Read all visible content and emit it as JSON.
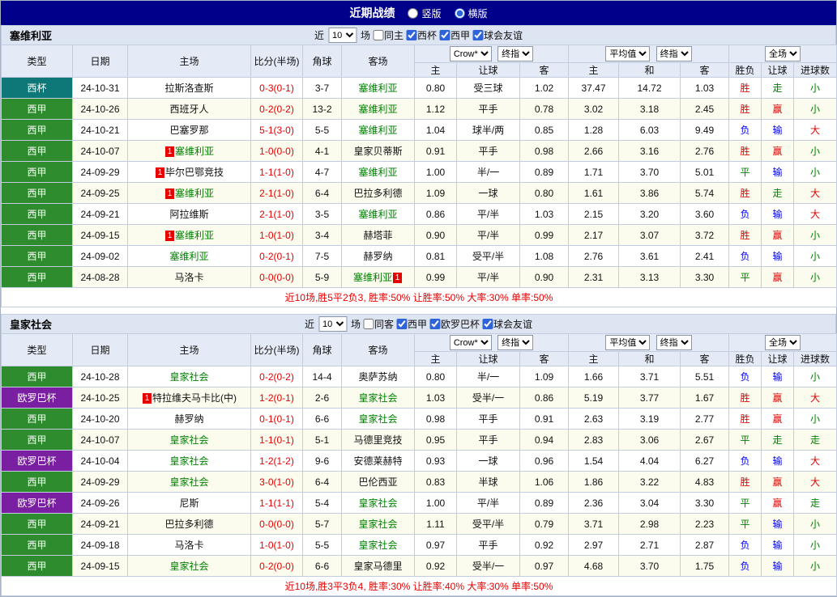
{
  "title_bar": {
    "title": "近期战绩",
    "vertical": "竖版",
    "horizontal": "横版",
    "selected": "横版"
  },
  "colors": {
    "title_navy": "#00008b",
    "liga_green": "#2e8b2e",
    "cup_teal": "#0e7878",
    "europa_purple": "#7b1fa2",
    "win_red": "#e60000",
    "loss_blue": "#0000ee",
    "draw_green": "#008000"
  },
  "columns": {
    "type": "类型",
    "date": "日期",
    "home": "主场",
    "score": "比分(半场)",
    "corner": "角球",
    "away": "客场",
    "odds_book": "Crow*",
    "odds_final": "终指",
    "avg": "平均值",
    "avg_final": "终指",
    "scope": "全场",
    "home_s": "主",
    "hand": "让球",
    "away_s": "客",
    "avg_h": "主",
    "avg_d": "和",
    "avg_a": "客",
    "res1": "胜负",
    "res2": "让球",
    "res3": "进球数"
  },
  "sections": [
    {
      "team": "塞维利亚",
      "filter": {
        "near": "近",
        "count": "10",
        "games": "场",
        "same": "同主",
        "leagues": [
          "西杯",
          "西甲",
          "球会友谊"
        ]
      },
      "rows": [
        {
          "type": "西杯",
          "type_color": "teal",
          "date": "24-10-31",
          "home": {
            "name": "拉斯洛查斯",
            "green": false,
            "badge": ""
          },
          "score": "0-3(0-1)",
          "corner": "3-7",
          "away": {
            "name": "塞维利亚",
            "green": true,
            "badge": ""
          },
          "odds": [
            "0.80",
            "受三球",
            "1.02"
          ],
          "avg": [
            "37.47",
            "14.72",
            "1.03"
          ],
          "results": [
            {
              "t": "胜",
              "c": "red"
            },
            {
              "t": "走",
              "c": "green"
            },
            {
              "t": "小",
              "c": "green"
            }
          ]
        },
        {
          "type": "西甲",
          "type_color": "green",
          "date": "24-10-26",
          "home": {
            "name": "西班牙人",
            "green": false,
            "badge": ""
          },
          "score": "0-2(0-2)",
          "corner": "13-2",
          "away": {
            "name": "塞维利亚",
            "green": true,
            "badge": ""
          },
          "odds": [
            "1.12",
            "平手",
            "0.78"
          ],
          "avg": [
            "3.02",
            "3.18",
            "2.45"
          ],
          "results": [
            {
              "t": "胜",
              "c": "red"
            },
            {
              "t": "赢",
              "c": "red"
            },
            {
              "t": "小",
              "c": "green"
            }
          ]
        },
        {
          "type": "西甲",
          "type_color": "green",
          "date": "24-10-21",
          "home": {
            "name": "巴塞罗那",
            "green": false,
            "badge": ""
          },
          "score": "5-1(3-0)",
          "corner": "5-5",
          "away": {
            "name": "塞维利亚",
            "green": true,
            "badge": ""
          },
          "odds": [
            "1.04",
            "球半/两",
            "0.85"
          ],
          "avg": [
            "1.28",
            "6.03",
            "9.49"
          ],
          "results": [
            {
              "t": "负",
              "c": "blue"
            },
            {
              "t": "输",
              "c": "blue"
            },
            {
              "t": "大",
              "c": "red"
            }
          ]
        },
        {
          "type": "西甲",
          "type_color": "green",
          "date": "24-10-07",
          "home": {
            "name": "塞维利亚",
            "green": true,
            "badge": "before"
          },
          "score": "1-0(0-0)",
          "corner": "4-1",
          "away": {
            "name": "皇家贝蒂斯",
            "green": false,
            "badge": ""
          },
          "odds": [
            "0.91",
            "平手",
            "0.98"
          ],
          "avg": [
            "2.66",
            "3.16",
            "2.76"
          ],
          "results": [
            {
              "t": "胜",
              "c": "red"
            },
            {
              "t": "赢",
              "c": "red"
            },
            {
              "t": "小",
              "c": "green"
            }
          ]
        },
        {
          "type": "西甲",
          "type_color": "green",
          "date": "24-09-29",
          "home": {
            "name": "毕尔巴鄂竞技",
            "green": false,
            "badge": "before"
          },
          "score": "1-1(1-0)",
          "corner": "4-7",
          "away": {
            "name": "塞维利亚",
            "green": true,
            "badge": ""
          },
          "odds": [
            "1.00",
            "半/一",
            "0.89"
          ],
          "avg": [
            "1.71",
            "3.70",
            "5.01"
          ],
          "results": [
            {
              "t": "平",
              "c": "green"
            },
            {
              "t": "输",
              "c": "blue"
            },
            {
              "t": "小",
              "c": "green"
            }
          ]
        },
        {
          "type": "西甲",
          "type_color": "green",
          "date": "24-09-25",
          "home": {
            "name": "塞维利亚",
            "green": true,
            "badge": "before"
          },
          "score": "2-1(1-0)",
          "corner": "6-4",
          "away": {
            "name": "巴拉多利德",
            "green": false,
            "badge": ""
          },
          "odds": [
            "1.09",
            "一球",
            "0.80"
          ],
          "avg": [
            "1.61",
            "3.86",
            "5.74"
          ],
          "results": [
            {
              "t": "胜",
              "c": "red"
            },
            {
              "t": "走",
              "c": "green"
            },
            {
              "t": "大",
              "c": "red"
            }
          ]
        },
        {
          "type": "西甲",
          "type_color": "green",
          "date": "24-09-21",
          "home": {
            "name": "阿拉维斯",
            "green": false,
            "badge": ""
          },
          "score": "2-1(1-0)",
          "corner": "3-5",
          "away": {
            "name": "塞维利亚",
            "green": true,
            "badge": ""
          },
          "odds": [
            "0.86",
            "平/半",
            "1.03"
          ],
          "avg": [
            "2.15",
            "3.20",
            "3.60"
          ],
          "results": [
            {
              "t": "负",
              "c": "blue"
            },
            {
              "t": "输",
              "c": "blue"
            },
            {
              "t": "大",
              "c": "red"
            }
          ]
        },
        {
          "type": "西甲",
          "type_color": "green",
          "date": "24-09-15",
          "home": {
            "name": "塞维利亚",
            "green": true,
            "badge": "before"
          },
          "score": "1-0(1-0)",
          "corner": "3-4",
          "away": {
            "name": "赫塔菲",
            "green": false,
            "badge": ""
          },
          "odds": [
            "0.90",
            "平/半",
            "0.99"
          ],
          "avg": [
            "2.17",
            "3.07",
            "3.72"
          ],
          "results": [
            {
              "t": "胜",
              "c": "red"
            },
            {
              "t": "赢",
              "c": "red"
            },
            {
              "t": "小",
              "c": "green"
            }
          ]
        },
        {
          "type": "西甲",
          "type_color": "green",
          "date": "24-09-02",
          "home": {
            "name": "塞维利亚",
            "green": true,
            "badge": ""
          },
          "score": "0-2(0-1)",
          "corner": "7-5",
          "away": {
            "name": "赫罗纳",
            "green": false,
            "badge": ""
          },
          "odds": [
            "0.81",
            "受平/半",
            "1.08"
          ],
          "avg": [
            "2.76",
            "3.61",
            "2.41"
          ],
          "results": [
            {
              "t": "负",
              "c": "blue"
            },
            {
              "t": "输",
              "c": "blue"
            },
            {
              "t": "小",
              "c": "green"
            }
          ]
        },
        {
          "type": "西甲",
          "type_color": "green",
          "date": "24-08-28",
          "home": {
            "name": "马洛卡",
            "green": false,
            "badge": ""
          },
          "score": "0-0(0-0)",
          "corner": "5-9",
          "away": {
            "name": "塞维利亚",
            "green": true,
            "badge": "after"
          },
          "odds": [
            "0.99",
            "平/半",
            "0.90"
          ],
          "avg": [
            "2.31",
            "3.13",
            "3.30"
          ],
          "results": [
            {
              "t": "平",
              "c": "green"
            },
            {
              "t": "赢",
              "c": "red"
            },
            {
              "t": "小",
              "c": "green"
            }
          ]
        }
      ],
      "summary": "近10场,胜5平2负3, 胜率:50% 让胜率:50% 大率:30% 单率:50%"
    },
    {
      "team": "皇家社会",
      "filter": {
        "near": "近",
        "count": "10",
        "games": "场",
        "same": "同客",
        "leagues": [
          "西甲",
          "欧罗巴杯",
          "球会友谊"
        ]
      },
      "rows": [
        {
          "type": "西甲",
          "type_color": "green",
          "date": "24-10-28",
          "home": {
            "name": "皇家社会",
            "green": true,
            "badge": ""
          },
          "score": "0-2(0-2)",
          "corner": "14-4",
          "away": {
            "name": "奥萨苏纳",
            "green": false,
            "badge": ""
          },
          "odds": [
            "0.80",
            "半/一",
            "1.09"
          ],
          "avg": [
            "1.66",
            "3.71",
            "5.51"
          ],
          "results": [
            {
              "t": "负",
              "c": "blue"
            },
            {
              "t": "输",
              "c": "blue"
            },
            {
              "t": "小",
              "c": "green"
            }
          ]
        },
        {
          "type": "欧罗巴杯",
          "type_color": "purple",
          "date": "24-10-25",
          "home": {
            "name": "特拉维夫马卡比(中)",
            "green": false,
            "badge": "before"
          },
          "score": "1-2(0-1)",
          "corner": "2-6",
          "away": {
            "name": "皇家社会",
            "green": true,
            "badge": ""
          },
          "odds": [
            "1.03",
            "受半/一",
            "0.86"
          ],
          "avg": [
            "5.19",
            "3.77",
            "1.67"
          ],
          "results": [
            {
              "t": "胜",
              "c": "red"
            },
            {
              "t": "赢",
              "c": "red"
            },
            {
              "t": "大",
              "c": "red"
            }
          ]
        },
        {
          "type": "西甲",
          "type_color": "green",
          "date": "24-10-20",
          "home": {
            "name": "赫罗纳",
            "green": false,
            "badge": ""
          },
          "score": "0-1(0-1)",
          "corner": "6-6",
          "away": {
            "name": "皇家社会",
            "green": true,
            "badge": ""
          },
          "odds": [
            "0.98",
            "平手",
            "0.91"
          ],
          "avg": [
            "2.63",
            "3.19",
            "2.77"
          ],
          "results": [
            {
              "t": "胜",
              "c": "red"
            },
            {
              "t": "赢",
              "c": "red"
            },
            {
              "t": "小",
              "c": "green"
            }
          ]
        },
        {
          "type": "西甲",
          "type_color": "green",
          "date": "24-10-07",
          "home": {
            "name": "皇家社会",
            "green": true,
            "badge": ""
          },
          "score": "1-1(0-1)",
          "corner": "5-1",
          "away": {
            "name": "马德里竞技",
            "green": false,
            "badge": ""
          },
          "odds": [
            "0.95",
            "平手",
            "0.94"
          ],
          "avg": [
            "2.83",
            "3.06",
            "2.67"
          ],
          "results": [
            {
              "t": "平",
              "c": "green"
            },
            {
              "t": "走",
              "c": "green"
            },
            {
              "t": "走",
              "c": "green"
            }
          ]
        },
        {
          "type": "欧罗巴杯",
          "type_color": "purple",
          "date": "24-10-04",
          "home": {
            "name": "皇家社会",
            "green": true,
            "badge": ""
          },
          "score": "1-2(1-2)",
          "corner": "9-6",
          "away": {
            "name": "安德莱赫特",
            "green": false,
            "badge": ""
          },
          "odds": [
            "0.93",
            "一球",
            "0.96"
          ],
          "avg": [
            "1.54",
            "4.04",
            "6.27"
          ],
          "results": [
            {
              "t": "负",
              "c": "blue"
            },
            {
              "t": "输",
              "c": "blue"
            },
            {
              "t": "大",
              "c": "red"
            }
          ]
        },
        {
          "type": "西甲",
          "type_color": "green",
          "date": "24-09-29",
          "home": {
            "name": "皇家社会",
            "green": true,
            "badge": ""
          },
          "score": "3-0(1-0)",
          "corner": "6-4",
          "away": {
            "name": "巴伦西亚",
            "green": false,
            "badge": ""
          },
          "odds": [
            "0.83",
            "半球",
            "1.06"
          ],
          "avg": [
            "1.86",
            "3.22",
            "4.83"
          ],
          "results": [
            {
              "t": "胜",
              "c": "red"
            },
            {
              "t": "赢",
              "c": "red"
            },
            {
              "t": "大",
              "c": "red"
            }
          ]
        },
        {
          "type": "欧罗巴杯",
          "type_color": "purple",
          "date": "24-09-26",
          "home": {
            "name": "尼斯",
            "green": false,
            "badge": ""
          },
          "score": "1-1(1-1)",
          "corner": "5-4",
          "away": {
            "name": "皇家社会",
            "green": true,
            "badge": ""
          },
          "odds": [
            "1.00",
            "平/半",
            "0.89"
          ],
          "avg": [
            "2.36",
            "3.04",
            "3.30"
          ],
          "results": [
            {
              "t": "平",
              "c": "green"
            },
            {
              "t": "赢",
              "c": "red"
            },
            {
              "t": "走",
              "c": "green"
            }
          ]
        },
        {
          "type": "西甲",
          "type_color": "green",
          "date": "24-09-21",
          "home": {
            "name": "巴拉多利德",
            "green": false,
            "badge": ""
          },
          "score": "0-0(0-0)",
          "corner": "5-7",
          "away": {
            "name": "皇家社会",
            "green": true,
            "badge": ""
          },
          "odds": [
            "1.11",
            "受平/半",
            "0.79"
          ],
          "avg": [
            "3.71",
            "2.98",
            "2.23"
          ],
          "results": [
            {
              "t": "平",
              "c": "green"
            },
            {
              "t": "输",
              "c": "blue"
            },
            {
              "t": "小",
              "c": "green"
            }
          ]
        },
        {
          "type": "西甲",
          "type_color": "green",
          "date": "24-09-18",
          "home": {
            "name": "马洛卡",
            "green": false,
            "badge": ""
          },
          "score": "1-0(1-0)",
          "corner": "5-5",
          "away": {
            "name": "皇家社会",
            "green": true,
            "badge": ""
          },
          "odds": [
            "0.97",
            "平手",
            "0.92"
          ],
          "avg": [
            "2.97",
            "2.71",
            "2.87"
          ],
          "results": [
            {
              "t": "负",
              "c": "blue"
            },
            {
              "t": "输",
              "c": "blue"
            },
            {
              "t": "小",
              "c": "green"
            }
          ]
        },
        {
          "type": "西甲",
          "type_color": "green",
          "date": "24-09-15",
          "home": {
            "name": "皇家社会",
            "green": true,
            "badge": ""
          },
          "score": "0-2(0-0)",
          "corner": "6-6",
          "away": {
            "name": "皇家马德里",
            "green": false,
            "badge": ""
          },
          "odds": [
            "0.92",
            "受半/一",
            "0.97"
          ],
          "avg": [
            "4.68",
            "3.70",
            "1.75"
          ],
          "results": [
            {
              "t": "负",
              "c": "blue"
            },
            {
              "t": "输",
              "c": "blue"
            },
            {
              "t": "小",
              "c": "green"
            }
          ]
        }
      ],
      "summary": "近10场,胜3平3负4, 胜率:30% 让胜率:40% 大率:30% 单率:50%"
    }
  ]
}
